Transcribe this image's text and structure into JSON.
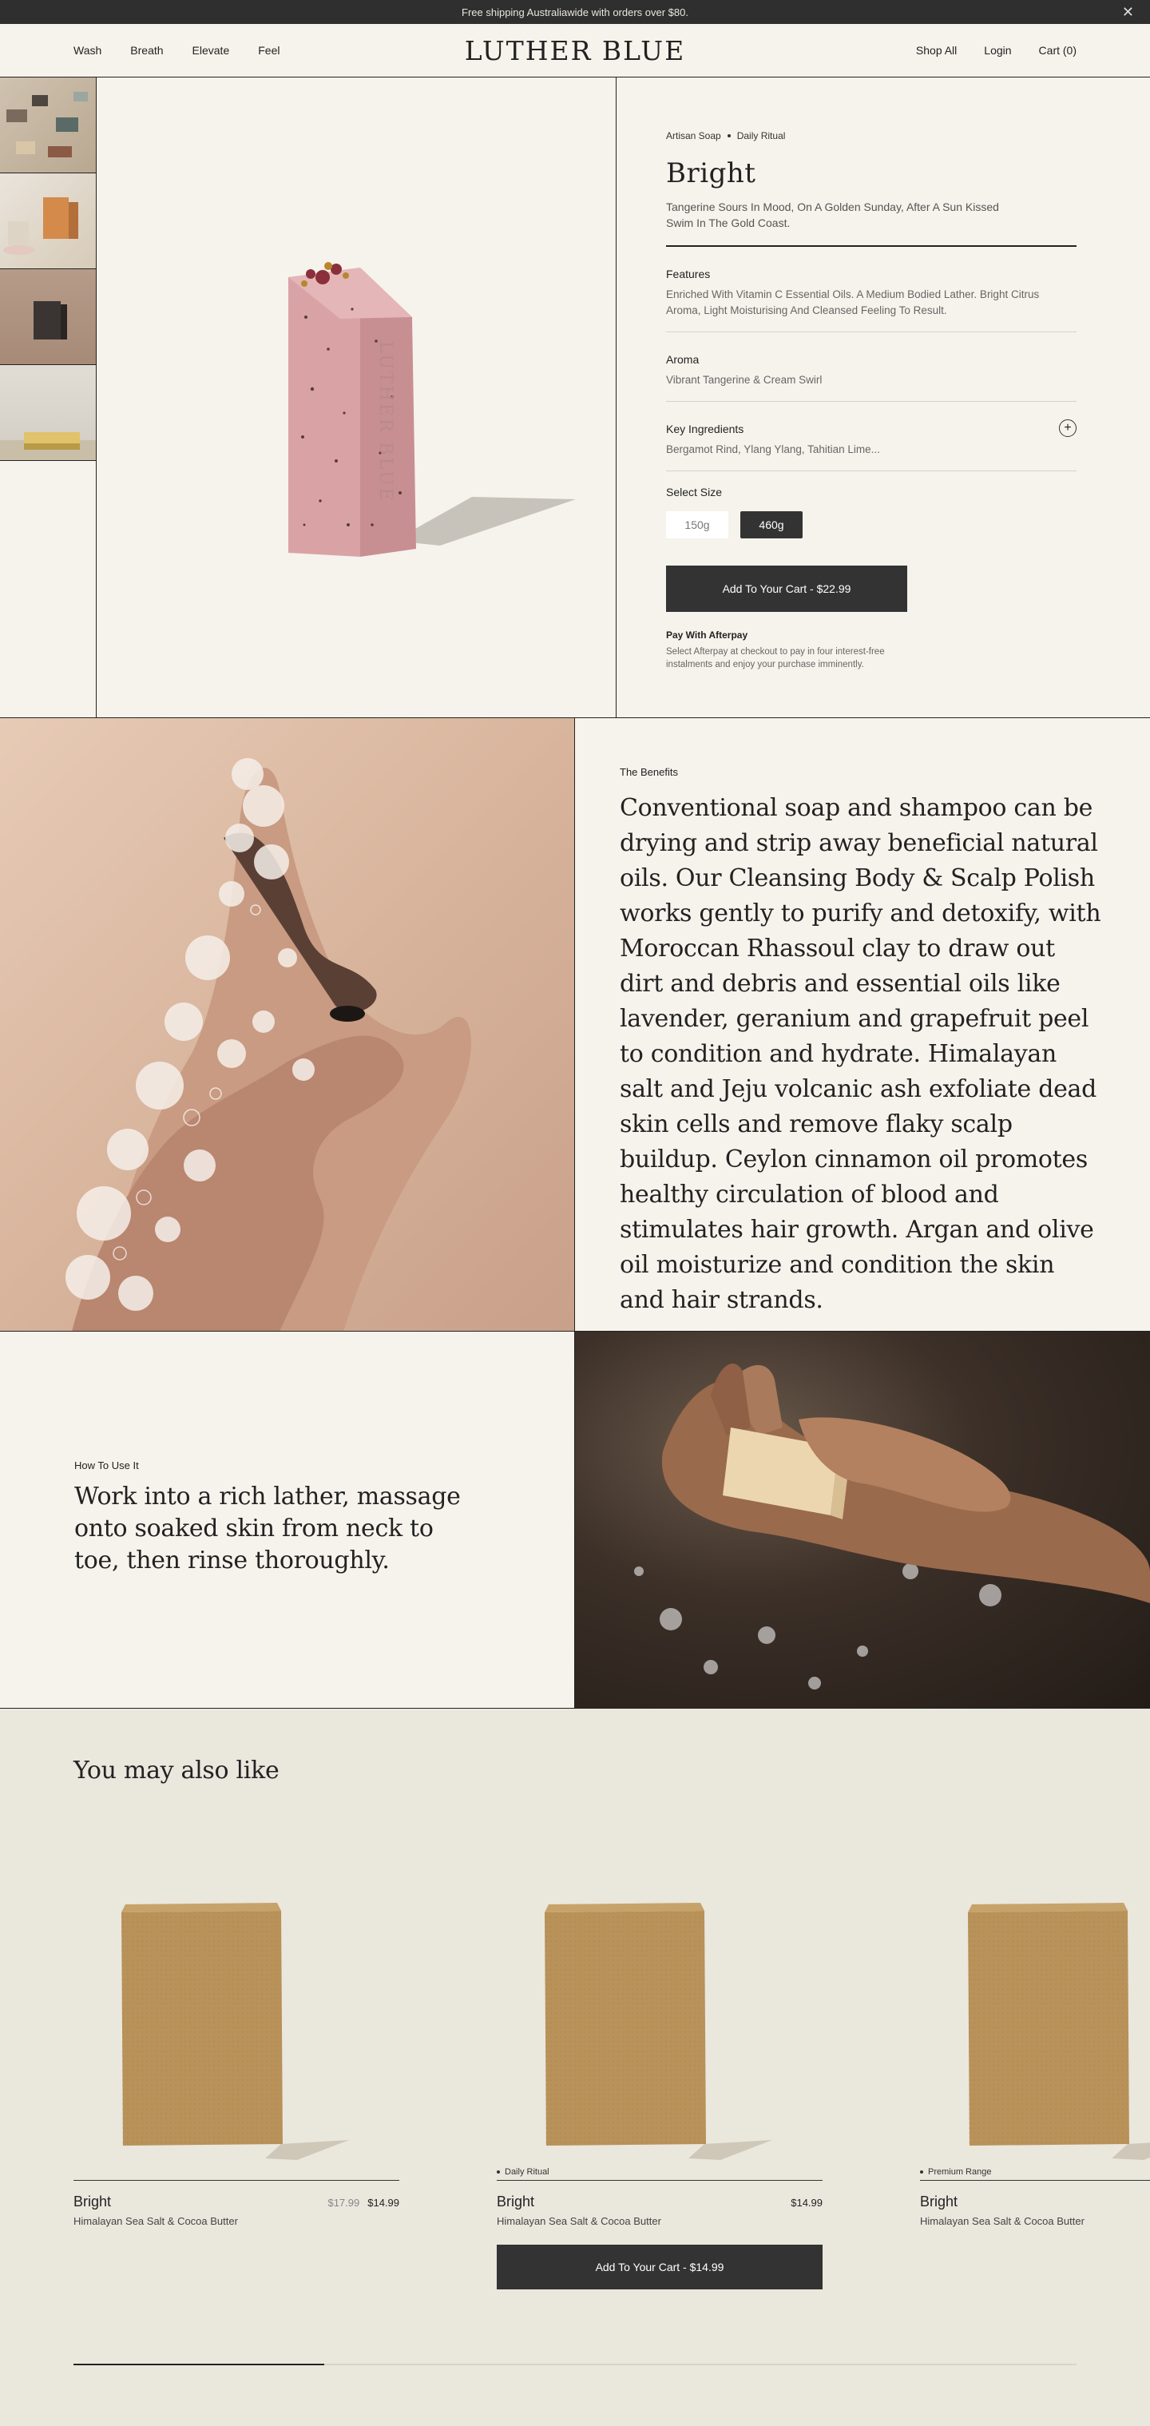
{
  "announcement": {
    "text": "Free shipping Australiawide with orders over $80.",
    "close": "✕"
  },
  "nav": {
    "left": [
      "Wash",
      "Breath",
      "Elevate",
      "Feel"
    ],
    "logo": "LUTHER BLUE",
    "shop_all": "Shop All",
    "login": "Login",
    "cart": "Cart (0)"
  },
  "product": {
    "breadcrumb": [
      "Artisan Soap",
      "Daily Ritual"
    ],
    "title": "Bright",
    "description": "Tangerine Sours In Mood, On A Golden Sunday, After A Sun Kissed Swim In The Gold Coast.",
    "features": {
      "label": "Features",
      "text": "Enriched With Vitamin C Essential Oils. A Medium Bodied Lather. Bright Citrus Aroma, Light Moisturising And Cleansed Feeling To Result."
    },
    "aroma": {
      "label": "Aroma",
      "text": "Vibrant Tangerine & Cream Swirl"
    },
    "ingredients": {
      "label": "Key Ingredients",
      "text": "Bergamot Rind, Ylang Ylang, Tahitian Lime..."
    },
    "size": {
      "label": "Select Size",
      "options": [
        "150g",
        "460g"
      ],
      "selected": "460g"
    },
    "add_to_cart": "Add To Your Cart - $22.99",
    "afterpay": {
      "title": "Pay With Afterpay",
      "text": "Select Afterpay at checkout to pay in four interest-free instalments and enjoy your purchase imminently."
    },
    "soap_stamp": "LUTHER BLUE"
  },
  "benefits": {
    "eyebrow": "The Benefits",
    "body": "Conventional soap and shampoo can be drying and strip away beneficial natural oils. Our Cleansing Body & Scalp Polish works gently to purify and detoxify, with Moroccan Rhassoul clay to draw out dirt and debris and essential oils like lavender, geranium and grapefruit peel to condition and hydrate. Himalayan salt and Jeju volcanic ash exfoliate dead skin cells and remove flaky scalp buildup. Ceylon cinnamon oil promotes healthy circulation of blood and stimulates hair growth. Argan and olive oil moisturize and condition the skin and hair strands."
  },
  "howto": {
    "eyebrow": "How To Use It",
    "body": "Work into a rich lather, massage onto soaked skin from neck to toe, then rinse thoroughly."
  },
  "also_like": {
    "heading": "You may also like",
    "cards": [
      {
        "tag": "",
        "name": "Bright",
        "sub": "Himalayan Sea Salt & Cocoa Butter",
        "old_price": "$17.99",
        "price": "$14.99",
        "add": ""
      },
      {
        "tag": "Daily Ritual",
        "name": "Bright",
        "sub": "Himalayan Sea Salt & Cocoa Butter",
        "old_price": "",
        "price": "$14.99",
        "add": "Add To Your Cart - $14.99"
      },
      {
        "tag": "Premium Range",
        "name": "Bright",
        "sub": "Himalayan Sea Salt & Cocoa Butter",
        "old_price": "",
        "price": "",
        "add": ""
      }
    ],
    "carousel_progress": 0.25
  },
  "colors": {
    "dark": "#2f2f2f",
    "cream": "#f6f3ec",
    "beige": "#eae7dd",
    "soap_pink": "#d9a3a3",
    "soap_tan": "#b9925a"
  }
}
